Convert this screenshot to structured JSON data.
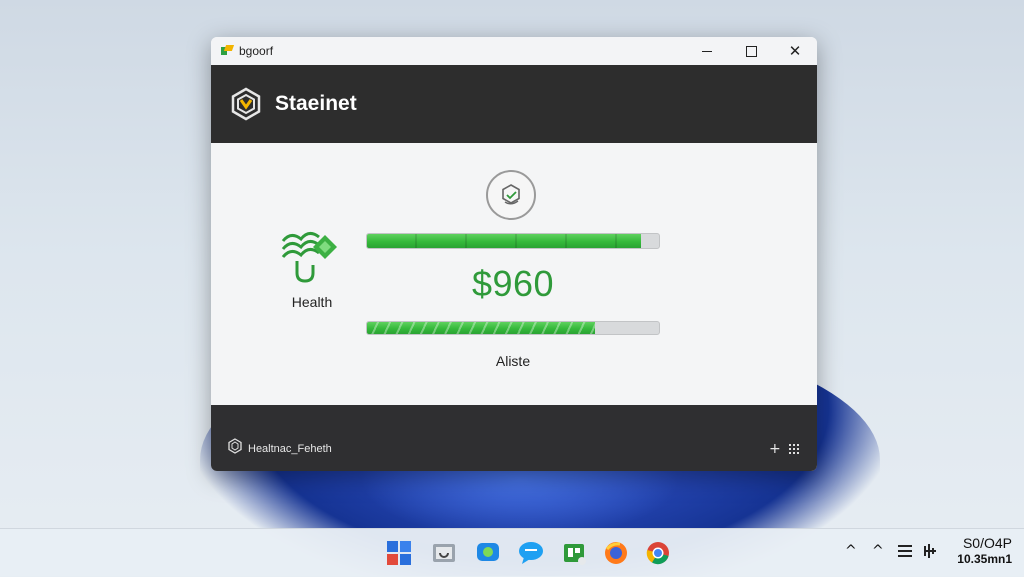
{
  "window": {
    "title": "bgoorf",
    "min_symbol": "",
    "close_symbol": "✕"
  },
  "header": {
    "brand": "Staeinet"
  },
  "main": {
    "health_label": "Health",
    "amount": "$960",
    "bar_label": "Aliste",
    "progress_top": 0.94,
    "progress_bottom": 0.78
  },
  "footer": {
    "label": "Healtnac_Feheth",
    "plus": "+"
  },
  "taskbar": {
    "apps": [
      "start-icon",
      "file-explorer-icon",
      "chat-icon",
      "messages-icon",
      "store-icon",
      "firefox-icon",
      "chrome-icon"
    ],
    "tray": [
      "^",
      "^"
    ],
    "time": "S0/O4P",
    "date": "10.35mn1"
  },
  "colors": {
    "accent_green": "#35b93b",
    "amount_green": "#2f9a3a",
    "header_bg": "#2d2d2d",
    "footer_bg": "#2f2f31"
  }
}
